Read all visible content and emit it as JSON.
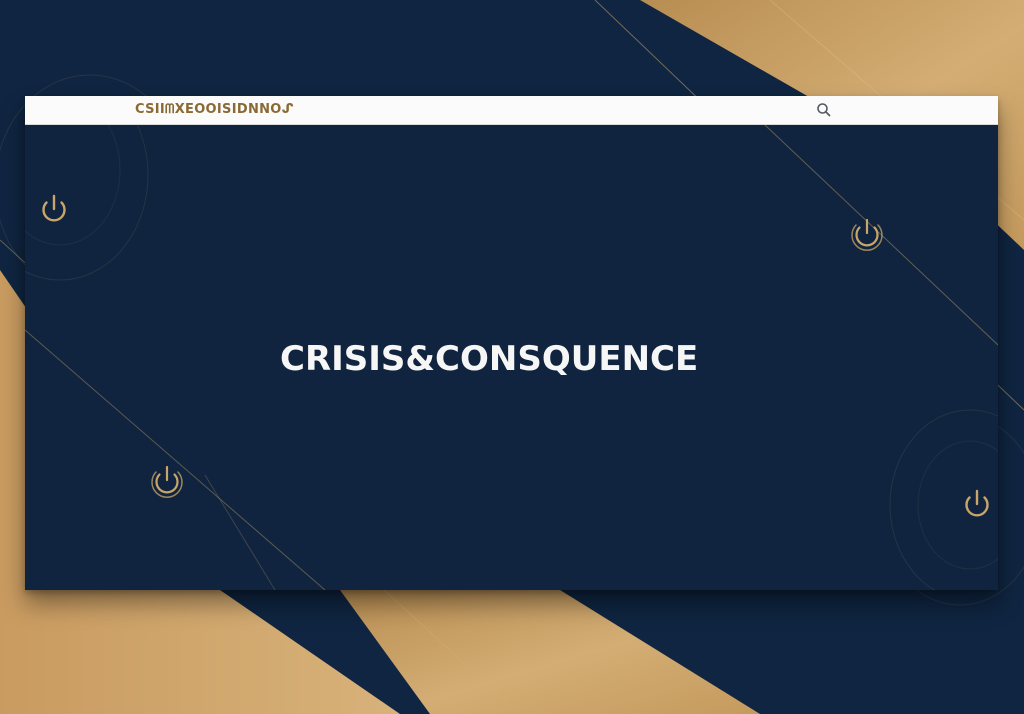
{
  "window": {
    "brand_text": "CSIIᗰXEOOISIDNNOᔑ"
  },
  "hero": {
    "title": "CRISIS&CONSQUENCE"
  },
  "icons": {
    "search": "search-icon",
    "power": "power-icon"
  },
  "colors": {
    "navy": "#10243f",
    "gold": "#c9a56a",
    "topbar": "#fbfbfb",
    "title": "#f6f6f6"
  }
}
